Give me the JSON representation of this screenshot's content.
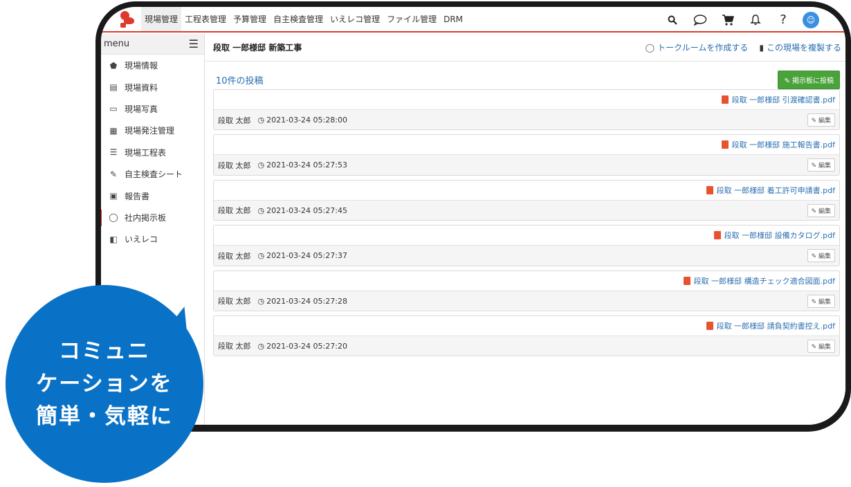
{
  "nav": {
    "items": [
      "現場管理",
      "工程表管理",
      "予算管理",
      "自主検査管理",
      "いえレコ管理",
      "ファイル管理",
      "DRM"
    ],
    "icons": [
      "search-icon",
      "chat-bubble-icon",
      "cart-icon",
      "bell-icon",
      "help-icon",
      "user-avatar"
    ],
    "accent": "#e0392b"
  },
  "sidebar": {
    "title": "menu",
    "items": [
      {
        "label": "現場情報",
        "icon": "house-icon"
      },
      {
        "label": "現場資料",
        "icon": "document-icon"
      },
      {
        "label": "現場写真",
        "icon": "image-icon"
      },
      {
        "label": "現場発注管理",
        "icon": "calculator-icon"
      },
      {
        "label": "現場工程表",
        "icon": "gantt-icon"
      },
      {
        "label": "自主検査シート",
        "icon": "edit-icon"
      },
      {
        "label": "報告書",
        "icon": "report-icon"
      },
      {
        "label": "社内掲示板",
        "icon": "chat-bubble-icon"
      },
      {
        "label": "いえレコ",
        "icon": "house-record-icon"
      }
    ]
  },
  "page": {
    "title": "段取 一郎様邸 新築工事",
    "create_talkroom": "トークルームを作成する",
    "duplicate_site": "この現場を複製する",
    "posts_count": "10件の投稿",
    "post_button": "掲示板に投稿",
    "edit_label": "編集"
  },
  "posts": [
    {
      "file": "段取 一郎様邸 引渡確認書.pdf",
      "author": "段取 太郎",
      "time": "2021-03-24 05:28:00"
    },
    {
      "file": "段取 一郎様邸 施工報告書.pdf",
      "author": "段取 太郎",
      "time": "2021-03-24 05:27:53"
    },
    {
      "file": "段取 一郎様邸 着工許可申請書.pdf",
      "author": "段取 太郎",
      "time": "2021-03-24 05:27:45"
    },
    {
      "file": "段取 一郎様邸 設備カタログ.pdf",
      "author": "段取 太郎",
      "time": "2021-03-24 05:27:37"
    },
    {
      "file": "段取 一郎様邸 構造チェック適合図面.pdf",
      "author": "段取 太郎",
      "time": "2021-03-24 05:27:28"
    },
    {
      "file": "段取 一郎様邸 請負契約書控え.pdf",
      "author": "段取 太郎",
      "time": "2021-03-24 05:27:20"
    }
  ],
  "bubble": {
    "lines": [
      "コミュニ",
      "ケーションを",
      "簡単・気軽に"
    ],
    "color": "#0a72c6"
  }
}
